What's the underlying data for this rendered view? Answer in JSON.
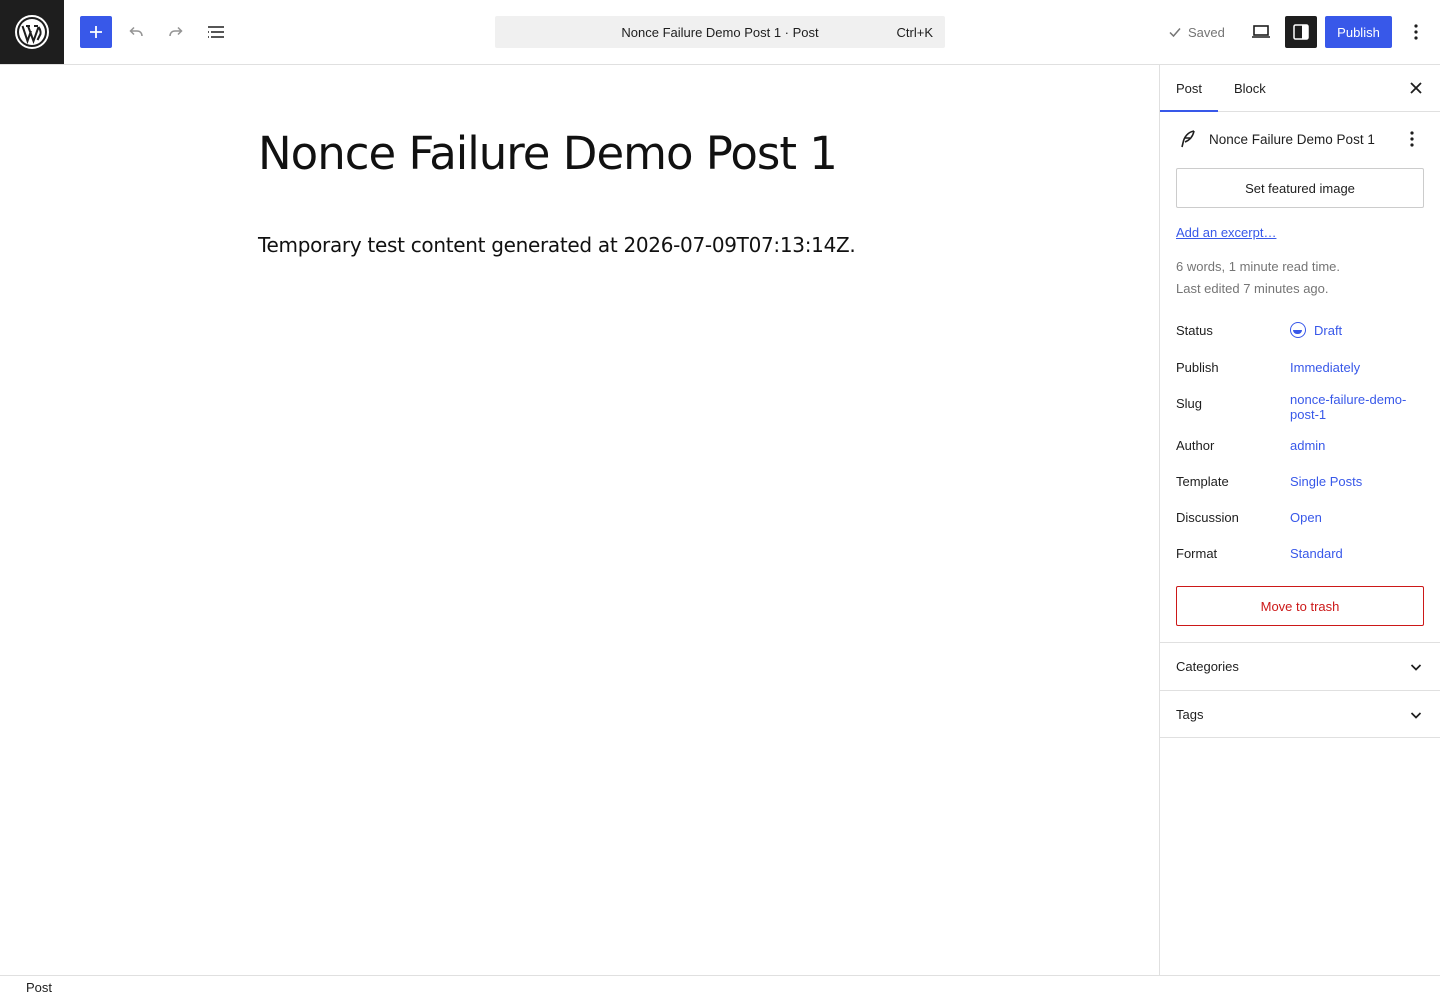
{
  "topbar": {
    "logo_icon": "wordpress-logo-icon",
    "command_title": "Nonce Failure Demo Post 1 · Post",
    "command_shortcut": "Ctrl+K",
    "saved_label": "Saved",
    "publish_label": "Publish"
  },
  "editor": {
    "title": "Nonce Failure Demo Post 1",
    "content": "Temporary test content generated at 2026-07-09T07:13:14Z."
  },
  "sidebar": {
    "tabs": [
      {
        "label": "Post",
        "active": true
      },
      {
        "label": "Block",
        "active": false
      }
    ],
    "summary": {
      "title": "Nonce Failure Demo Post 1",
      "featured_image_label": "Set featured image",
      "excerpt_link": "Add an excerpt…",
      "word_count_text": "6 words, 1 minute read time.",
      "last_edited_text": "Last edited 7 minutes ago."
    },
    "rows": [
      {
        "label": "Status",
        "value": "Draft"
      },
      {
        "label": "Publish",
        "value": "Immediately"
      },
      {
        "label": "Slug",
        "value": "nonce-failure-demo-post-1"
      },
      {
        "label": "Author",
        "value": "admin"
      },
      {
        "label": "Template",
        "value": "Single Posts"
      },
      {
        "label": "Discussion",
        "value": "Open"
      },
      {
        "label": "Format",
        "value": "Standard"
      }
    ],
    "trash_label": "Move to trash",
    "panels": [
      {
        "label": "Categories"
      },
      {
        "label": "Tags"
      }
    ]
  },
  "footer": {
    "breadcrumb": "Post"
  },
  "colors": {
    "accent": "#3858e9",
    "danger": "#cc1818",
    "dark": "#1e1e1e"
  }
}
